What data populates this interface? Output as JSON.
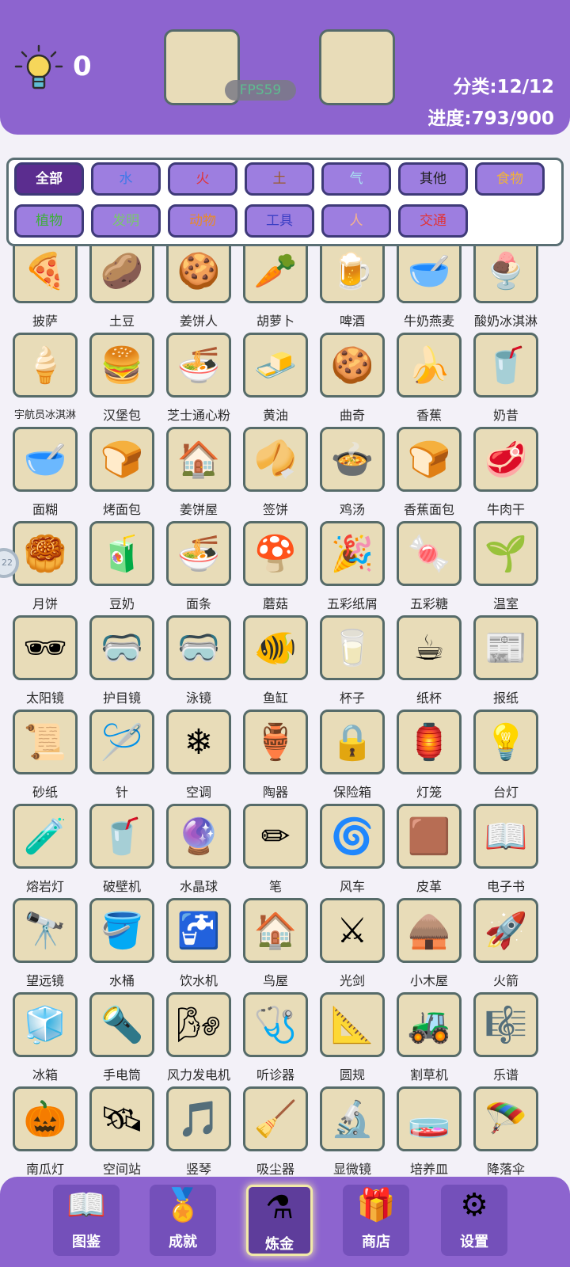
{
  "hud": {
    "hints": "0",
    "fps": "FPS59",
    "category_progress": "分类:12/12",
    "total_progress": "进度:793/900"
  },
  "categories": [
    {
      "label": "全部",
      "color": "#ffffff"
    },
    {
      "label": "水",
      "color": "#3f78e8"
    },
    {
      "label": "火",
      "color": "#e0343a"
    },
    {
      "label": "土",
      "color": "#9a5b2c"
    },
    {
      "label": "气",
      "color": "#a9e2f2"
    },
    {
      "label": "其他",
      "color": "#1f1f1f"
    },
    {
      "label": "食物",
      "color": "#f0b23a"
    },
    {
      "label": "植物",
      "color": "#3fae3c"
    },
    {
      "label": "发明",
      "color": "#79c86c"
    },
    {
      "label": "动物",
      "color": "#e88a2a"
    },
    {
      "label": "工具",
      "color": "#3c3fc4"
    },
    {
      "label": "人",
      "color": "#f5b38e"
    },
    {
      "label": "交通",
      "color": "#e0343a"
    }
  ],
  "side_badge": "22",
  "items": [
    {
      "name": "披萨",
      "icon": "🍕"
    },
    {
      "name": "土豆",
      "icon": "🥔"
    },
    {
      "name": "姜饼人",
      "icon": "🍪"
    },
    {
      "name": "胡萝卜",
      "icon": "🥕"
    },
    {
      "name": "啤酒",
      "icon": "🍺"
    },
    {
      "name": "牛奶燕麦",
      "icon": "🥣"
    },
    {
      "name": "酸奶冰淇淋",
      "icon": "🍨"
    },
    {
      "name": "宇航员冰淇淋",
      "icon": "🍦"
    },
    {
      "name": "汉堡包",
      "icon": "🍔"
    },
    {
      "name": "芝士通心粉",
      "icon": "🍜"
    },
    {
      "name": "黄油",
      "icon": "🧈"
    },
    {
      "name": "曲奇",
      "icon": "🍪"
    },
    {
      "name": "香蕉",
      "icon": "🍌"
    },
    {
      "name": "奶昔",
      "icon": "🥤"
    },
    {
      "name": "面糊",
      "icon": "🥣"
    },
    {
      "name": "烤面包",
      "icon": "🍞"
    },
    {
      "name": "姜饼屋",
      "icon": "🏠"
    },
    {
      "name": "签饼",
      "icon": "🥠"
    },
    {
      "name": "鸡汤",
      "icon": "🍲"
    },
    {
      "name": "香蕉面包",
      "icon": "🍞"
    },
    {
      "name": "牛肉干",
      "icon": "🥩"
    },
    {
      "name": "月饼",
      "icon": "🥮"
    },
    {
      "name": "豆奶",
      "icon": "🧃"
    },
    {
      "name": "面条",
      "icon": "🍜"
    },
    {
      "name": "蘑菇",
      "icon": "🍄"
    },
    {
      "name": "五彩纸屑",
      "icon": "🎉"
    },
    {
      "name": "五彩糖",
      "icon": "🍬"
    },
    {
      "name": "温室",
      "icon": "🌱"
    },
    {
      "name": "太阳镜",
      "icon": "🕶"
    },
    {
      "name": "护目镜",
      "icon": "🥽"
    },
    {
      "name": "泳镜",
      "icon": "🥽"
    },
    {
      "name": "鱼缸",
      "icon": "🐠"
    },
    {
      "name": "杯子",
      "icon": "🥛"
    },
    {
      "name": "纸杯",
      "icon": "☕"
    },
    {
      "name": "报纸",
      "icon": "📰"
    },
    {
      "name": "砂纸",
      "icon": "📜"
    },
    {
      "name": "针",
      "icon": "🪡"
    },
    {
      "name": "空调",
      "icon": "❄"
    },
    {
      "name": "陶器",
      "icon": "🏺"
    },
    {
      "name": "保险箱",
      "icon": "🔒"
    },
    {
      "name": "灯笼",
      "icon": "🏮"
    },
    {
      "name": "台灯",
      "icon": "💡"
    },
    {
      "name": "熔岩灯",
      "icon": "🧪"
    },
    {
      "name": "破壁机",
      "icon": "🥤"
    },
    {
      "name": "水晶球",
      "icon": "🔮"
    },
    {
      "name": "笔",
      "icon": "✏"
    },
    {
      "name": "风车",
      "icon": "🌀"
    },
    {
      "name": "皮革",
      "icon": "🟫"
    },
    {
      "name": "电子书",
      "icon": "📖"
    },
    {
      "name": "望远镜",
      "icon": "🔭"
    },
    {
      "name": "水桶",
      "icon": "🪣"
    },
    {
      "name": "饮水机",
      "icon": "🚰"
    },
    {
      "name": "鸟屋",
      "icon": "🏠"
    },
    {
      "name": "光剑",
      "icon": "⚔"
    },
    {
      "name": "小木屋",
      "icon": "🛖"
    },
    {
      "name": "火箭",
      "icon": "🚀"
    },
    {
      "name": "冰箱",
      "icon": "🧊"
    },
    {
      "name": "手电筒",
      "icon": "🔦"
    },
    {
      "name": "风力发电机",
      "icon": "🌬"
    },
    {
      "name": "听诊器",
      "icon": "🩺"
    },
    {
      "name": "圆规",
      "icon": "📐"
    },
    {
      "name": "割草机",
      "icon": "🚜"
    },
    {
      "name": "乐谱",
      "icon": "🎼"
    },
    {
      "name": "南瓜灯",
      "icon": "🎃"
    },
    {
      "name": "空间站",
      "icon": "🛰"
    },
    {
      "name": "竖琴",
      "icon": "🎵"
    },
    {
      "name": "吸尘器",
      "icon": "🧹"
    },
    {
      "name": "显微镜",
      "icon": "🔬"
    },
    {
      "name": "培养皿",
      "icon": "🧫"
    },
    {
      "name": "降落伞",
      "icon": "🪂"
    }
  ],
  "nav": [
    {
      "label": "图鉴",
      "icon": "📖",
      "active": false
    },
    {
      "label": "成就",
      "icon": "🏅",
      "active": false
    },
    {
      "label": "炼金",
      "icon": "⚗",
      "active": true
    },
    {
      "label": "商店",
      "icon": "🎁",
      "active": false
    },
    {
      "label": "设置",
      "icon": "⚙",
      "active": false
    }
  ]
}
